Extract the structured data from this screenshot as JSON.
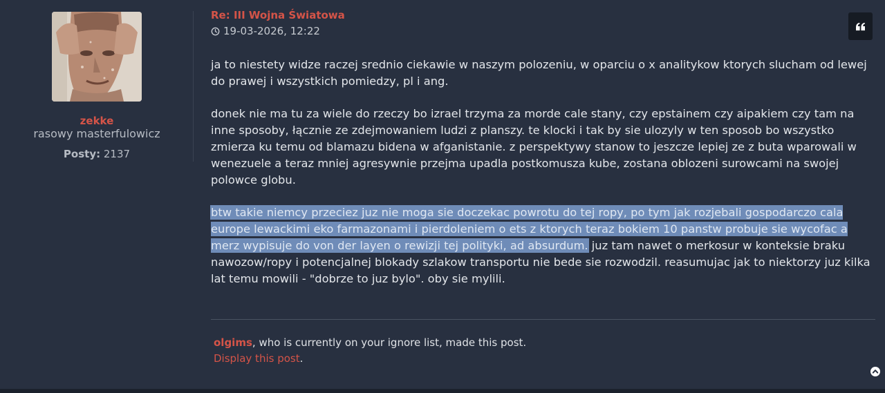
{
  "author": {
    "username": "zekke",
    "rank": "rasowy masterfulowicz",
    "posts_label": "Posty:",
    "posts_count": "2137"
  },
  "post": {
    "title": "Re: III Wojna Światowa",
    "date": "19-03-2026, 12:22",
    "quote_icon": "quote-icon",
    "paragraphs": {
      "p1": "ja to niestety widze raczej srednio ciekawie w naszym polozeniu, w oparciu o x analitykow ktorych slucham od lewej do prawej i wszystkich pomiedzy, pl i ang.",
      "p2": "donek nie ma tu za wiele do rzeczy bo izrael trzyma za morde cale stany, czy epstainem czy aipakiem czy tam na inne sposoby, łącznie ze zdejmowaniem ludzi z planszy. te klocki i tak by sie ulozyly w ten sposob bo wszystko zmierza ku temu od blamazu bidena w afganistanie. z perspektywy stanow to jeszcze lepiej ze z buta wparowali w wenezuele a teraz mniej agresywnie przejma upadla postkomusza kube, zostana oblozeni surowcami na swojej polowce globu.",
      "p3_selected": "btw takie niemcy przeciez juz nie moga sie doczekac powrotu do tej ropy, po tym jak rozjebali gospodarczo cala europe lewackimi eko farmazonami i pierdoleniem o ets z ktorych teraz bokiem 10 panstw probuje sie wycofac a merz wypisuje do von der layen o rewizji tej polityki, ad absurdum.",
      "p3_rest": " juz tam nawet o merkosur w konteksie braku nawozow/ropy i potencjalnej blokady szlakow transportu nie bede sie rozwodzil. reasumujac jak to niektorzy juz kilka lat temu mowili - \"dobrze to juz bylo\". oby sie mylili."
    }
  },
  "ignored_post": {
    "username": "olgims",
    "notice_text": ", who is currently on your ignore list, made this post.",
    "display_link": "Display this post",
    "display_suffix": "."
  },
  "colors": {
    "background": "#283040",
    "accent": "#d55448",
    "selection": "#6f8cb8"
  },
  "icons": {
    "clock": "clock-icon",
    "quote": "quote-icon",
    "back_to_top": "arrow-up-circle-icon"
  }
}
